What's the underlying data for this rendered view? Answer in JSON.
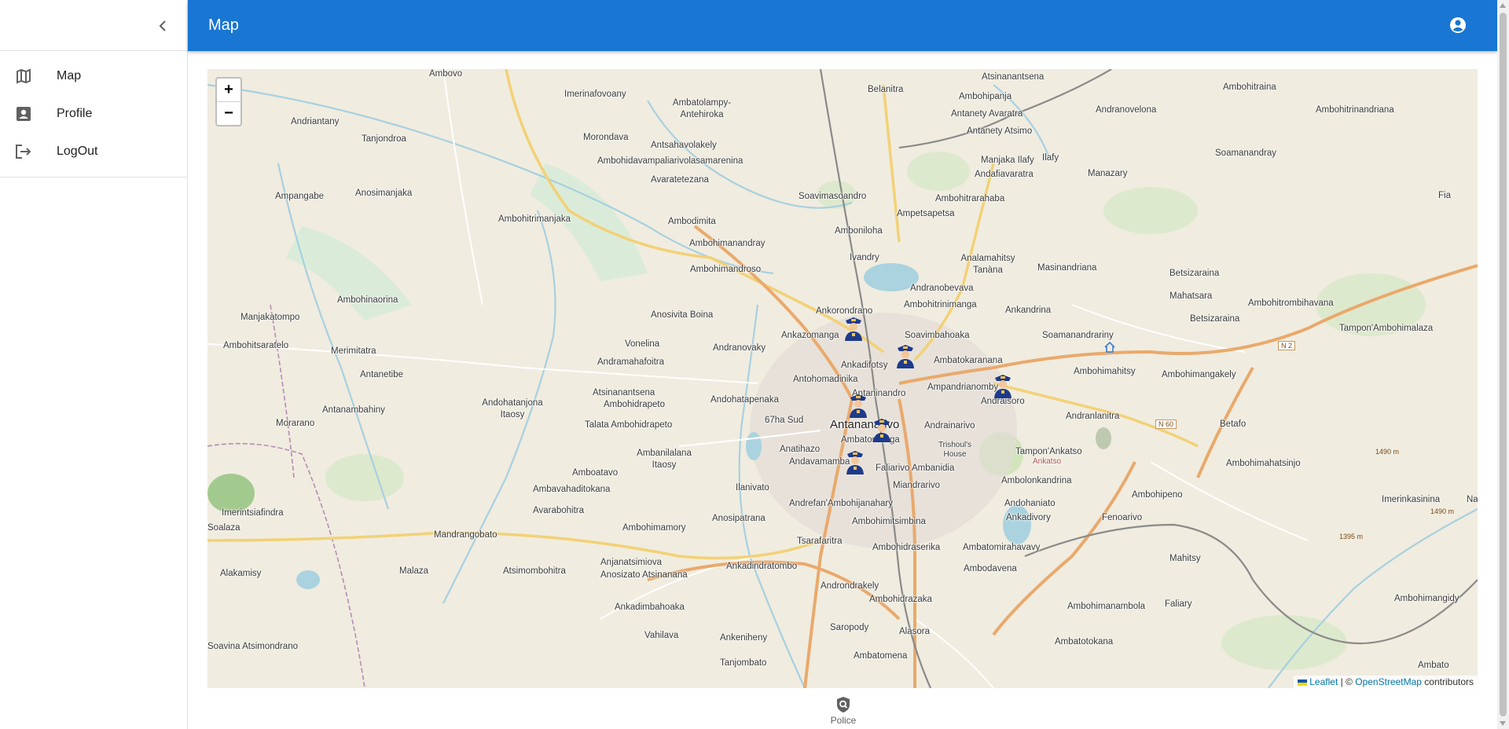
{
  "app": {
    "title": "Map"
  },
  "sidebar": {
    "items": [
      {
        "label": "Map",
        "icon": "map-icon"
      },
      {
        "label": "Profile",
        "icon": "profile-icon"
      },
      {
        "label": "LogOut",
        "icon": "logout-icon"
      }
    ]
  },
  "header": {
    "title": "Map",
    "account_icon": "account-circle-icon"
  },
  "map": {
    "zoom_in": "+",
    "zoom_out": "−",
    "attribution": {
      "leaflet": "Leaflet",
      "sep": " | © ",
      "osm": "OpenStreetMap",
      "suffix": " contributors"
    },
    "city": "Antananarivo",
    "places": [
      "Ambovo",
      "Atsinanantsena",
      "Imerinafovoany",
      "Ambatolampy-Antehiroka",
      "Belanitra",
      "Ambohipanja",
      "Ambohitraina",
      "Ambohitrinandriana",
      "Andriantany",
      "Tanjondroa",
      "Morondava",
      "Antsahavolakely",
      "Ambohidavampaliarivolasamarenina",
      "Avaratetezana",
      "Antanety Avaratra",
      "Antanety Atsimo",
      "Andranovelona",
      "Ilafy",
      "Manjaka Ilafy",
      "Andafiavaratra",
      "Manazary",
      "Soamanandray",
      "Ampangabe",
      "Anosimanjaka",
      "Ambohitrimanjaka",
      "Ambodimita",
      "Soavimasoandro",
      "Ampetsapetsa",
      "Amboniloha",
      "Ambohitrarahaba",
      "Ambohimanandray",
      "Ivandry",
      "Analamahitsy Tanàna",
      "Masinandriana",
      "Ambohimandroso",
      "Betsizaraina",
      "Mahatsara",
      "Andranobevava",
      "Ambohitrinimanga",
      "Ambohitrombihavana",
      "Ambohinaorina",
      "Manjakatompo",
      "Anosivita Boina",
      "Ankorondrano",
      "Ankandrina",
      "Betsizaraina",
      "Tampon'Ambohimalaza",
      "Ankazomanga",
      "Soavimbahoaka",
      "Soamanandrariny",
      "Vonelina",
      "Andranovaky",
      "Ambohitsaratelo",
      "Merimitatra",
      "Ambohimahitsy",
      "Ankadifotsy",
      "Ambatokaranana",
      "Andramahafoitra",
      "Antohomadinika",
      "Ambohimangakely",
      "Antanetibe",
      "Ampandrianomby",
      "Atsinanantsena",
      "Ambohidrapeto",
      "Andohatapenaka",
      "Antaninandro",
      "Andraisoro",
      "Antanambahiny",
      "Andohatanjona Itaosy",
      "Andranlanitra",
      "Morarano",
      "Talata Ambohidrapeto",
      "67ha Sud",
      "Andrainarivo",
      "Betafo",
      "Anatihazo",
      "Ambatomanga",
      "Ambanilalana Itaosy",
      "Andavamamba",
      "Trishoul's House",
      "Tampon'Ankatso",
      "Ankatso",
      "Ambohimahatsinjo",
      "Amboatavo",
      "Faliarivo Ambanidia",
      "Ambavahaditokana",
      "Ilanivato",
      "Miandrarivo",
      "Ambolonkandrina",
      "Ambohipeno",
      "Imerinkasinina",
      "Imerintsiafindra",
      "Avarabohitra",
      "Andrefan'Ambohijanahary",
      "Andohaniato",
      "Soalaza",
      "Ambohimamory",
      "Anosipatrana",
      "Ambohimitsimbina",
      "Ankadivory",
      "Fenoarivo",
      "Mandrangobato",
      "Tsarafaritra",
      "Ambohidraserika",
      "Ambatomirahavavy",
      "Anjanatsimiova",
      "Mahitsy",
      "Alakamisy",
      "Malaza",
      "Atsimombohitra",
      "Anosizato Atsinanana",
      "Ankadindratombo",
      "Ambodavena",
      "Ankadimbahoaka",
      "Androndrakely",
      "Ambohidrazaka",
      "Ambohimanambola",
      "Faliary",
      "Ambohimangidy",
      "Vahilava",
      "Ankeniheny",
      "Saropody",
      "Alasora",
      "Ambatotokana",
      "Soavina Atsimondrano",
      "Tanjombato",
      "Ambatomena",
      "Ambato",
      "Fia",
      "Nanjakana"
    ],
    "road_labels": [
      "N 2",
      "N 60",
      "1490 m",
      "1395 m",
      "1490 m"
    ],
    "markers": 7
  },
  "bottom_nav": {
    "label": "Police",
    "icon": "police-shield-icon"
  },
  "colors": {
    "primary": "#1976d2",
    "map_bg": "#f0ecdf",
    "water": "#aad3df",
    "road_major": "#f7c56e",
    "road_minor": "#ffffff"
  }
}
